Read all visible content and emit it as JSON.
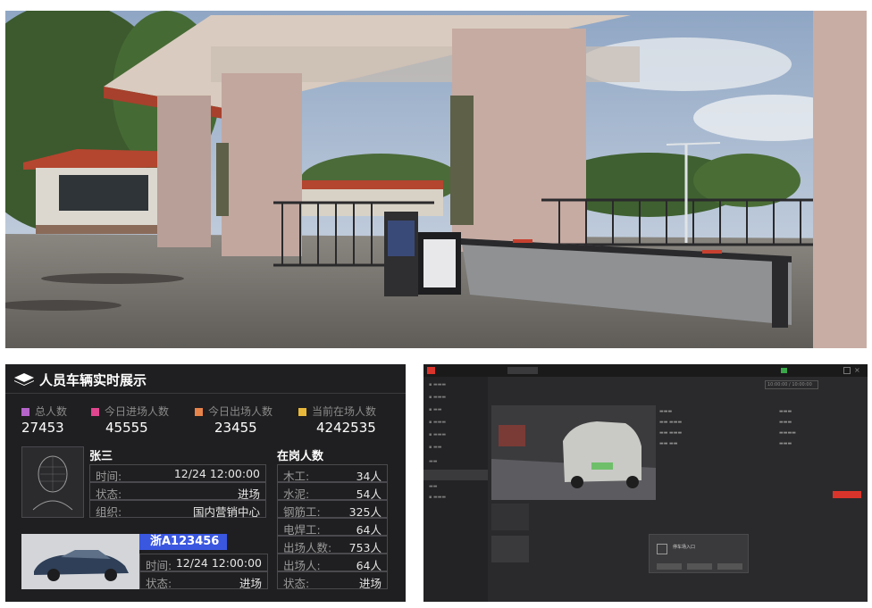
{
  "dashboard": {
    "title": "人员车辆实时展示",
    "stats": [
      {
        "label": "总人数",
        "value": "27453",
        "color": "#b565c9"
      },
      {
        "label": "今日进场人数",
        "value": "45555",
        "color": "#e0468f"
      },
      {
        "label": "今日出场人数",
        "value": "23455",
        "color": "#e8844a"
      },
      {
        "label": "当前在场人数",
        "value": "4242535",
        "color": "#e8b83a"
      }
    ],
    "person": {
      "name": "张三",
      "time_label": "时间:",
      "time_value": "12/24  12:00:00",
      "status_label": "状态:",
      "status_value": "进场",
      "org_label": "组织:",
      "org_value": "国内营销中心"
    },
    "onduty": {
      "title": "在岗人数",
      "rows": [
        {
          "label": "木工:",
          "value": "34人"
        },
        {
          "label": "水泥:",
          "value": "54人"
        },
        {
          "label": "钢筋工:",
          "value": "325人"
        },
        {
          "label": "电焊工:",
          "value": "64人"
        },
        {
          "label": "出场人数:",
          "value": "753人"
        },
        {
          "label": "出场人:",
          "value": "64人"
        },
        {
          "label": "状态:",
          "value": "进场"
        }
      ]
    },
    "vehicle": {
      "plate": "浙A123456",
      "time_label": "时间:",
      "time_value": "12/24  12:00:00",
      "status_label": "状态:",
      "status_value": "进场"
    }
  },
  "software": {
    "accent": "#d9342b",
    "time_display": "10:00:00 / 10:00:00",
    "popup_title": "停车场入口"
  }
}
